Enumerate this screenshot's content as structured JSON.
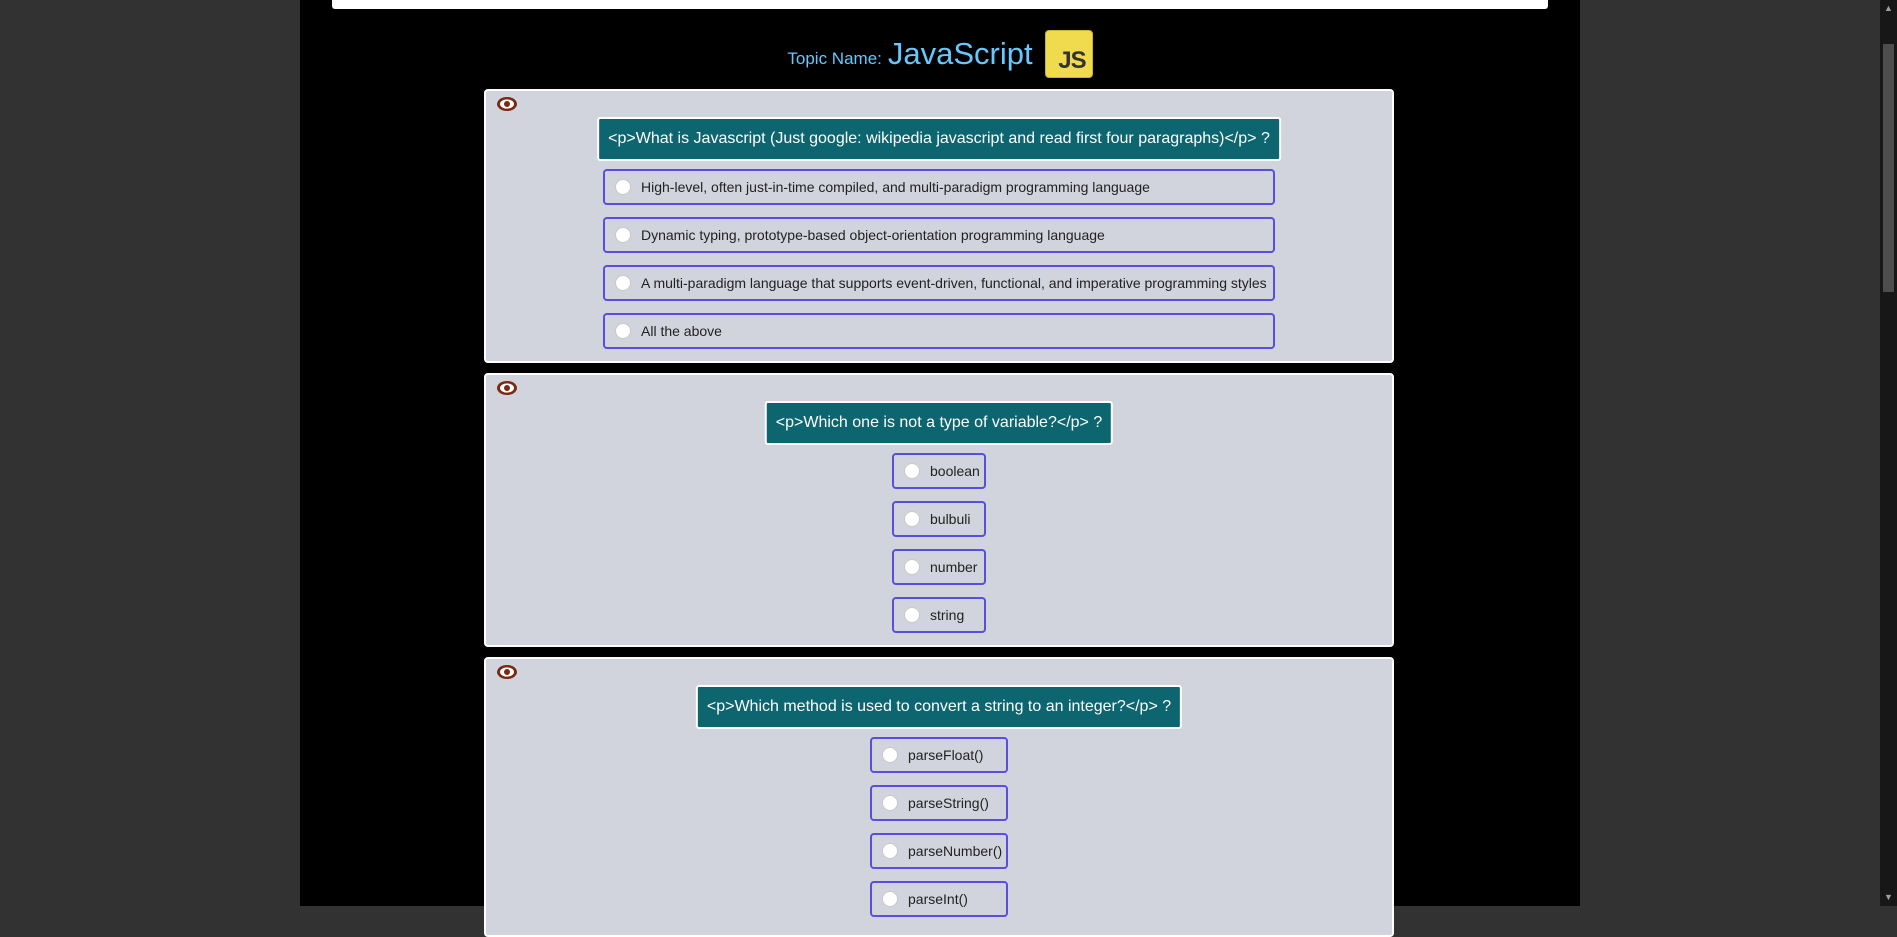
{
  "header": {
    "topic_label": "Topic Name:",
    "topic_name": "JavaScript",
    "logo_text": "JS"
  },
  "questions": [
    {
      "title": "<p>What is Javascript (Just google: wikipedia javascript and read first four paragraphs)</p> ?",
      "options": [
        "High-level, often just-in-time compiled, and multi-paradigm programming language",
        "Dynamic typing, prototype-based object-orientation programming language",
        "A multi-paradigm language that supports event-driven, functional, and imperative programming styles",
        "All the above"
      ]
    },
    {
      "title": "<p>Which one is not a type of variable?</p> ?",
      "options": [
        "boolean",
        "bulbuli",
        "number",
        "string"
      ]
    },
    {
      "title": "<p>Which method is used to convert a string to an integer?</p> ?",
      "options": [
        "parseFloat()",
        "parseString()",
        "parseNumber()",
        "parseInt()"
      ]
    }
  ],
  "colors": {
    "question_bg": "#0d6570",
    "option_border": "#5a4de0",
    "card_bg": "#d1d4dc",
    "topic_text": "#66c8ff",
    "eye_icon": "#7a2a12"
  },
  "icons": {
    "reveal": "eye-icon",
    "logo": "js-logo"
  }
}
